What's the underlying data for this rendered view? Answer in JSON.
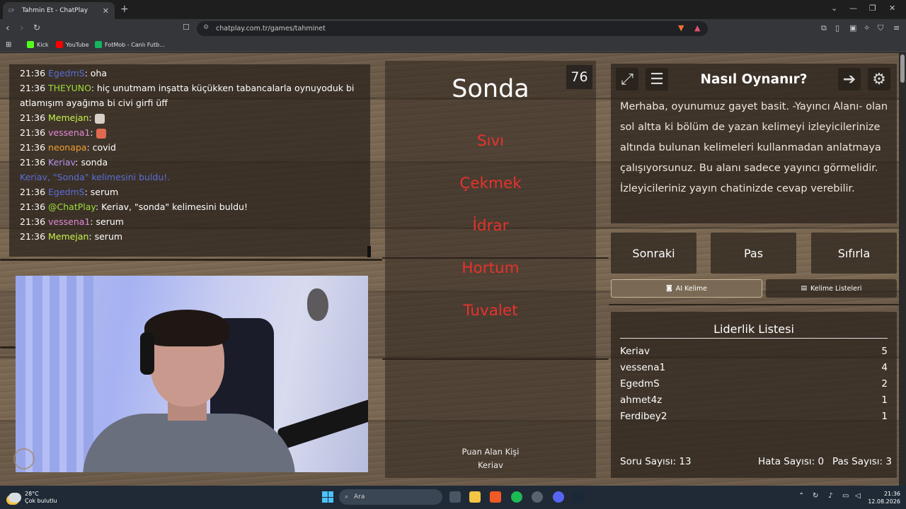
{
  "browser": {
    "tab_title": "Tahmin Et - ChatPlay",
    "tab_favicon": "CP",
    "url": "chatplay.com.tr/games/tahminet",
    "bookmarks": [
      {
        "label": "Kick",
        "color": "#53fc18"
      },
      {
        "label": "YouTube",
        "color": "#ff0000"
      },
      {
        "label": "FotMob - Canlı Futb...",
        "color": "#17b35f"
      }
    ]
  },
  "chat": {
    "messages": [
      {
        "time": "21:36",
        "user": "EgedmS",
        "color": "#5a6ed8",
        "text": ": oha"
      },
      {
        "time": "21:36",
        "user": "THEYUNO",
        "color": "#9dde3a",
        "text": ": hiç unutmam inşatta küçükken tabancalarla oynuyoduk bi atlamışım ayağıma bi civi girfi üff"
      },
      {
        "time": "21:36",
        "user": "Memejan",
        "color": "#c6f34a",
        "text": ": "
      },
      {
        "time": "21:36",
        "user": "vessena1",
        "color": "#e38ad9",
        "text": ": "
      },
      {
        "time": "21:36",
        "user": "neonapa",
        "color": "#f0a030",
        "text": ": covid"
      },
      {
        "time": "21:36",
        "user": "Keriav",
        "color": "#b894f0",
        "text": ": sonda"
      },
      {
        "system": "Keriav, \"Sonda\" kelimesini buldu!."
      },
      {
        "time": "21:36",
        "user": "EgedmS",
        "color": "#5a6ed8",
        "text": ": serum"
      },
      {
        "time": "21:36",
        "user": "@ChatPlay",
        "color": "#9dde3a",
        "text": ": Keriav, \"sonda\" kelimesini buldu!"
      },
      {
        "time": "21:36",
        "user": "vessena1",
        "color": "#e38ad9",
        "text": ": serum"
      },
      {
        "time": "21:36",
        "user": "Memejan",
        "color": "#c6f34a",
        "text": ": serum"
      }
    ]
  },
  "card": {
    "timer": "76",
    "word": "Sonda",
    "forbidden": [
      "Sıvı",
      "Çekmek",
      "İdrar",
      "Hortum",
      "Tuvalet"
    ],
    "scorer_label": "Puan Alan Kişi",
    "scorer_name": "Keriav"
  },
  "howto": {
    "title": "Nasıl Oynanır?",
    "text": "Merhaba, oyunumuz gayet basit. -Yayıncı Alanı- olan sol altta ki bölüm de yazan kelimeyi izleyicilerinize altında bulunan kelimeleri kullanmadan anlatmaya çalışıyorsunuz. Bu alanı sadece yayıncı görmelidir. İzleyicileriniz yayın chatinizde cevap verebilir."
  },
  "controls": {
    "next": "Sonraki",
    "pass": "Pas",
    "reset": "Sıfırla",
    "ai_word": "AI Kelime",
    "word_lists": "Kelime Listeleri"
  },
  "leaderboard": {
    "title": "Liderlik Listesi",
    "rows": [
      {
        "name": "Keriav",
        "score": "5"
      },
      {
        "name": "vessena1",
        "score": "4"
      },
      {
        "name": "EgedmS",
        "score": "2"
      },
      {
        "name": "ahmet4z",
        "score": "1"
      },
      {
        "name": "Ferdibey2",
        "score": "1"
      }
    ],
    "question_count": "Soru Sayısı: 13",
    "error_count": "Hata Sayısı: 0",
    "pass_count": "Pas Sayısı: 3"
  },
  "taskbar": {
    "temp": "28°C",
    "weather": "Çok bulutlu",
    "search": "Ara",
    "time": "21:36",
    "date": "12.08.2026"
  }
}
